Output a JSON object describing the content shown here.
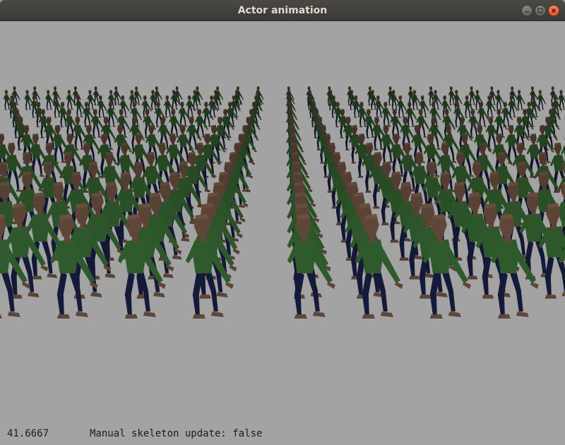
{
  "window": {
    "title": "Actor animation",
    "buttons": {
      "minimize": "minimize-icon",
      "maximize": "maximize-icon",
      "close": "close-icon"
    }
  },
  "scene": {
    "background_color": "#a3a3a3",
    "subject": "crowd of animated humanoid actors in a grid",
    "actor_colors": {
      "skin": "#5e4638",
      "shirt": "#2f5a2c",
      "pants": "#151a3a"
    }
  },
  "hud": {
    "fps": "41.6667",
    "status": "Manual skeleton update: false"
  }
}
